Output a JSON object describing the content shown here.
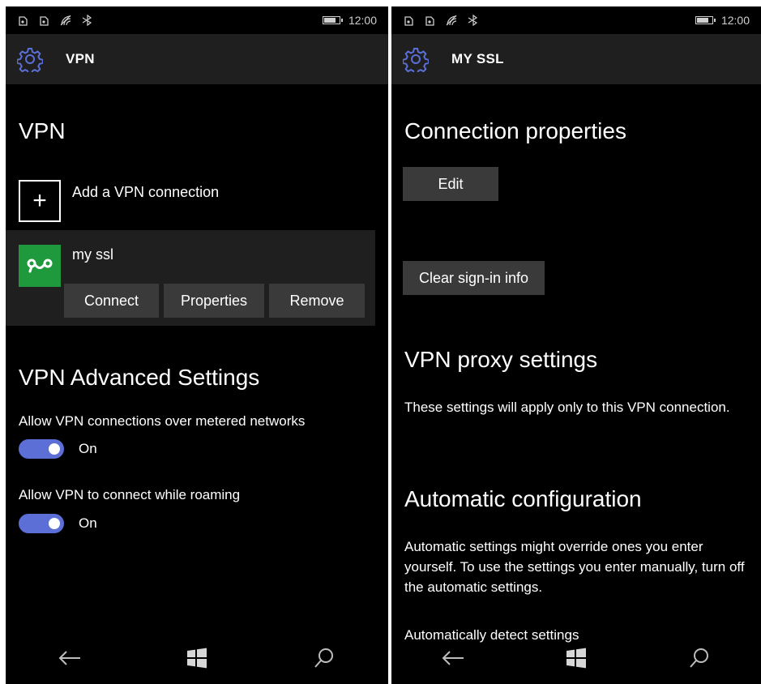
{
  "left": {
    "status": {
      "time": "12:00"
    },
    "header": {
      "title": "VPN"
    },
    "section_title": "VPN",
    "add_connection": {
      "icon": "+",
      "label": "Add a VPN connection"
    },
    "vpn_entry": {
      "name": "my ssl",
      "icon_color": "#1e9a3d",
      "actions": [
        "Connect",
        "Properties",
        "Remove"
      ]
    },
    "advanced": {
      "title": "VPN Advanced Settings",
      "metered": {
        "label": "Allow VPN connections over metered networks",
        "state": "On"
      },
      "roaming": {
        "label": "Allow VPN to connect while roaming",
        "state": "On"
      }
    }
  },
  "right": {
    "status": {
      "time": "12:00"
    },
    "header": {
      "title": "MY SSL"
    },
    "connection_properties": {
      "title": "Connection properties",
      "edit_label": "Edit",
      "clear_label": "Clear sign-in info"
    },
    "proxy": {
      "title": "VPN proxy settings",
      "description": "These settings will apply only to this VPN connection."
    },
    "auto_config": {
      "title": "Automatic configuration",
      "description": "Automatic settings might override ones you enter yourself. To use the settings you enter manually, turn off the automatic settings.",
      "detect_label": "Automatically detect settings"
    }
  },
  "theme": {
    "accent": "#5b6fd6",
    "header_bg": "#1f1f1f",
    "button_bg": "#3a3a3a"
  },
  "nav": {
    "back": "back-arrow-icon",
    "home": "windows-logo-icon",
    "search": "search-icon"
  }
}
